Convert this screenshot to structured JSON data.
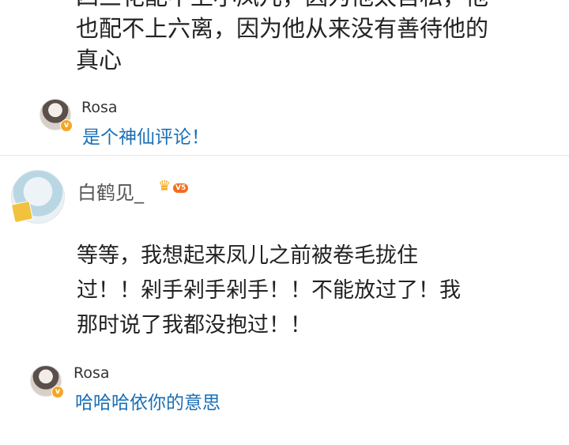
{
  "top_comment": {
    "lines": [
      "四三花配不上小凤儿，因为他太自私，他",
      "也配不上六离，因为他从来没有善待他的",
      "真心"
    ]
  },
  "reply_1": {
    "username": "Rosa",
    "content": "是个神仙评论！"
  },
  "main_comment": {
    "username": "白鹤见_",
    "level_badge": "V5",
    "lines": [
      "等等，我想起来凤儿之前被卷毛拢住",
      "过！！剁手剁手剁手！！不能放过了！我",
      "那时说了我都没抱过！！"
    ]
  },
  "reply_2": {
    "username": "Rosa",
    "content": "哈哈哈依你的意思"
  },
  "colors": {
    "reply_text": "#1a6fb5",
    "badge_orange": "#ef6e1f",
    "verified_gold": "#f5a623"
  }
}
